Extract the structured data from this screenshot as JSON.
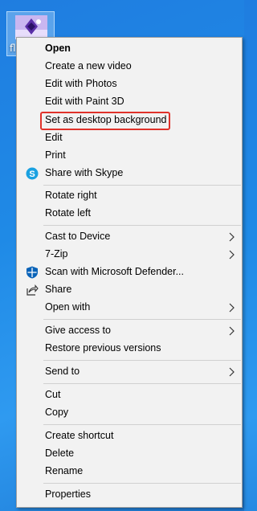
{
  "desktop": {
    "file_label": "fl"
  },
  "menu": {
    "items": [
      {
        "label": "Open"
      },
      {
        "label": "Create a new video"
      },
      {
        "label": "Edit with Photos"
      },
      {
        "label": "Edit with Paint 3D"
      },
      {
        "label": "Set as desktop background"
      },
      {
        "label": "Edit"
      },
      {
        "label": "Print"
      },
      {
        "label": "Share with Skype",
        "icon": "skype-icon"
      },
      {
        "label": "Rotate right"
      },
      {
        "label": "Rotate left"
      },
      {
        "label": "Cast to Device"
      },
      {
        "label": "7-Zip"
      },
      {
        "label": "Scan with Microsoft Defender...",
        "icon": "defender-shield-icon"
      },
      {
        "label": "Share",
        "icon": "share-icon"
      },
      {
        "label": "Open with"
      },
      {
        "label": "Give access to"
      },
      {
        "label": "Restore previous versions"
      },
      {
        "label": "Send to"
      },
      {
        "label": "Cut"
      },
      {
        "label": "Copy"
      },
      {
        "label": "Create shortcut"
      },
      {
        "label": "Delete"
      },
      {
        "label": "Rename"
      },
      {
        "label": "Properties"
      }
    ]
  },
  "colors": {
    "desktop_blue": "#1f8ae6",
    "menu_background": "#f2f2f2",
    "highlight_red": "#e0322a",
    "skype_blue": "#1aa1e1",
    "defender_blue": "#0a63b8"
  }
}
